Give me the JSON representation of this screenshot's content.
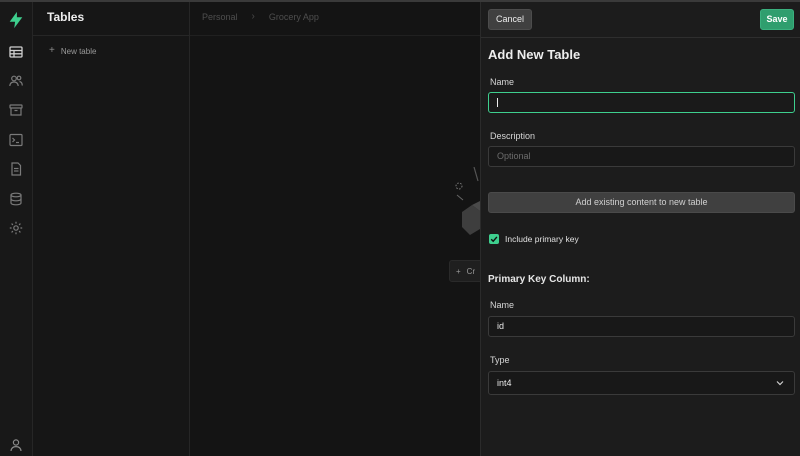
{
  "sidebar": {
    "title": "Tables",
    "new_table_label": "New table"
  },
  "main": {
    "breadcrumbs": [
      "Personal",
      "Grocery App"
    ],
    "create_button_label": "Cr"
  },
  "panel": {
    "cancel_label": "Cancel",
    "save_label": "Save",
    "title": "Add New Table",
    "name_label": "Name",
    "name_value": "",
    "description_label": "Description",
    "description_placeholder": "Optional",
    "add_existing_label": "Add existing content to new table",
    "include_pk_label": "Include primary key",
    "include_pk_checked": true,
    "pk_heading": "Primary Key Column:",
    "pk_name_label": "Name",
    "pk_name_value": "id",
    "pk_type_label": "Type",
    "pk_type_value": "int4"
  },
  "colors": {
    "accent": "#3ecf8e",
    "save_button": "#2f9e6e",
    "background": "#161616",
    "panel": "#1c1c1c"
  },
  "icons": [
    "logo-bolt-icon",
    "table-editor-icon",
    "users-icon",
    "archive-icon",
    "terminal-icon",
    "document-icon",
    "database-icon",
    "settings-gear-icon",
    "user-profile-icon",
    "plus-icon",
    "chevron-right-icon",
    "check-icon",
    "chevron-down-icon"
  ]
}
